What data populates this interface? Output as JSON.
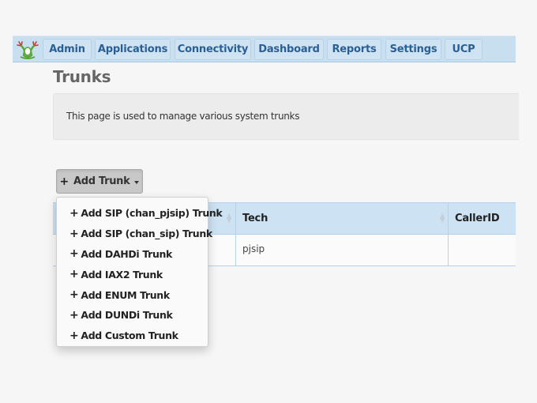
{
  "nav": {
    "logo": "freepbx-frog-logo",
    "items": [
      {
        "label": "Admin"
      },
      {
        "label": "Applications"
      },
      {
        "label": "Connectivity"
      },
      {
        "label": "Dashboard"
      },
      {
        "label": "Reports"
      },
      {
        "label": "Settings"
      },
      {
        "label": "UCP"
      }
    ]
  },
  "page": {
    "title": "Trunks",
    "description": "This page is used to manage various system trunks"
  },
  "add_trunk": {
    "label": "Add Trunk",
    "icon": "plus-icon",
    "menu": [
      {
        "label": "Add SIP (chan_pjsip) Trunk"
      },
      {
        "label": "Add SIP (chan_sip) Trunk"
      },
      {
        "label": "Add DAHDi Trunk"
      },
      {
        "label": "Add IAX2 Trunk"
      },
      {
        "label": "Add ENUM Trunk"
      },
      {
        "label": "Add DUNDi Trunk"
      },
      {
        "label": "Add Custom Trunk"
      }
    ]
  },
  "table": {
    "columns": [
      "",
      "Tech",
      "CallerID"
    ],
    "rows": [
      [
        "",
        "pjsip",
        ""
      ]
    ]
  },
  "colors": {
    "nav_bg": "#c8dff0",
    "nav_text": "#2a5f95",
    "table_header_bg": "#cde2f2",
    "page_bg": "#f6f6f6"
  }
}
